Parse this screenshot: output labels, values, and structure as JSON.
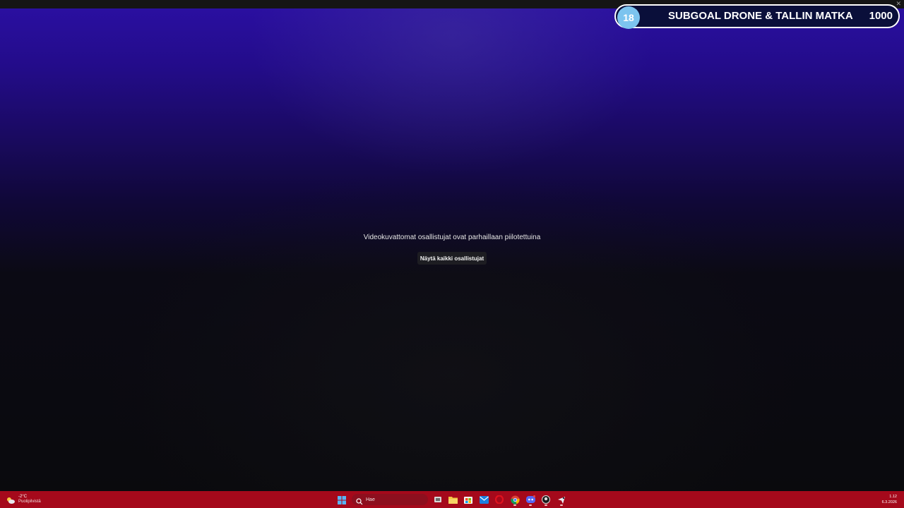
{
  "goal_overlay": {
    "badge": "18",
    "title": "SUBGOAL DRONE & TALLIN MATKA",
    "target": "1000"
  },
  "call": {
    "notice": "Videokuvattomat osallistujat ovat parhaillaan piilotettuina",
    "show_all_button": "Näytä kaikki osallistujat"
  },
  "taskbar": {
    "weather_temp": "-2°C",
    "weather_desc": "Puolipilvistä",
    "search_placeholder": "Hae",
    "apps": [
      "task-view-icon",
      "file-explorer-icon",
      "microsoft-store-icon",
      "mail-icon",
      "opera-icon",
      "chrome-icon",
      "discord-icon",
      "github-icon",
      "steam-icon"
    ],
    "time": "1.12",
    "date": "6.3.2026",
    "colors": {
      "taskbar": "#a5091b",
      "accent_blue": "#0078d4"
    }
  }
}
